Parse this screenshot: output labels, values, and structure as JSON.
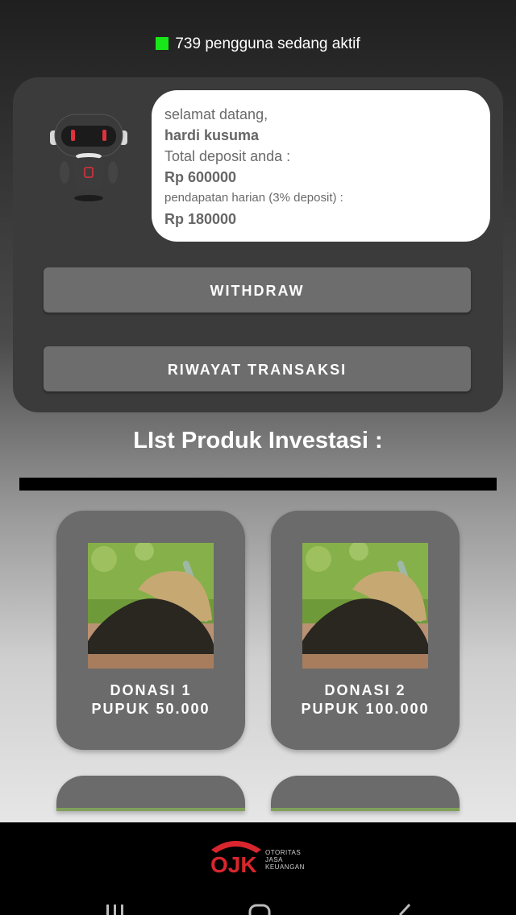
{
  "status": {
    "active_users_text": "739 pengguna sedang aktif",
    "indicator_color": "#19e619"
  },
  "welcome": {
    "greeting": "selamat datang,",
    "user_name": "hardi kusuma",
    "deposit_label": "Total deposit anda :",
    "deposit_value": "Rp 600000",
    "daily_label": "pendapatan harian (3% deposit) :",
    "daily_value": "Rp 180000"
  },
  "buttons": {
    "withdraw": "WITHDRAW",
    "history": "RIWAYAT TRANSAKSI"
  },
  "list_title": "LIst Produk Investasi :",
  "products": [
    {
      "line1": "DONASI 1",
      "line2": "PUPUK 50.000"
    },
    {
      "line1": "DONASI 2",
      "line2": "PUPUK 100.000"
    }
  ],
  "footer": {
    "logo_text": "OJK",
    "org_lines": [
      "OTORITAS",
      "JASA",
      "KEUANGAN"
    ]
  },
  "colors": {
    "card_bg": "#3b3b3b",
    "button_bg": "#6d6d6d",
    "product_bg": "#6b6b6b"
  },
  "icons": [
    "robot-avatar-icon",
    "soil-fertilizer-image",
    "ojk-logo",
    "recent-apps-icon",
    "home-icon",
    "back-icon"
  ]
}
